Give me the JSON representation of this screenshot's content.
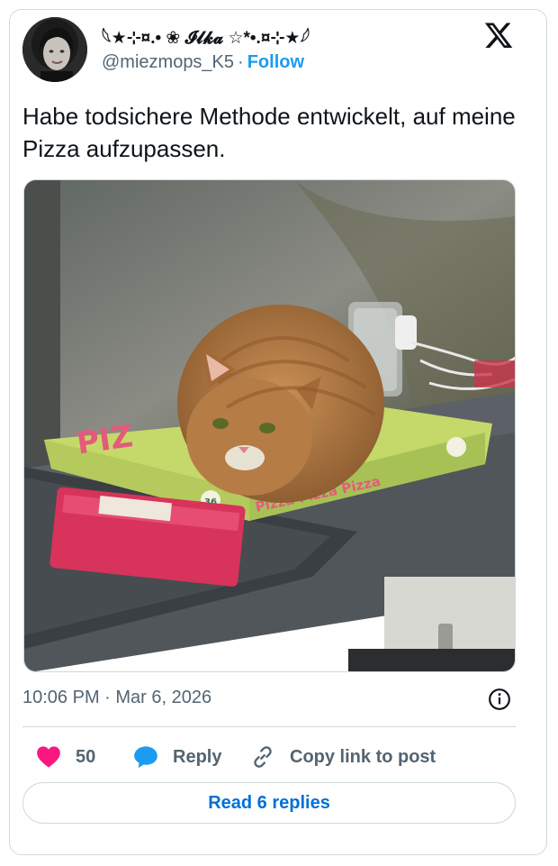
{
  "tweet": {
    "author": {
      "display_name": "𓆩★⊹¤.• ❀ 𝓘𝓵𝓴𝓪 ☆*•.¤⊹★𓆪",
      "handle": "@miezmops_K5",
      "separator": "·",
      "follow_label": "Follow"
    },
    "text": "Habe todsichere Methode entwickelt, auf meine Pizza aufzupassen.",
    "photo": {
      "box_text": "Pizza Pizza Pizza",
      "box_badge": "36",
      "box_side_text": "PIZ"
    },
    "timestamp": "10:06 PM · Mar 6, 2026",
    "actions": {
      "likes_count": "50",
      "reply_label": "Reply",
      "copy_link_label": "Copy link to post"
    },
    "read_replies_label": "Read 6 replies"
  },
  "colors": {
    "like": "#f91880",
    "reply": "#1d9bf0",
    "link": "#006fd6",
    "muted": "#536471",
    "border": "#cfd9de"
  },
  "icons": [
    "x-logo-icon",
    "heart-icon",
    "reply-bubble-icon",
    "link-icon",
    "info-icon"
  ]
}
